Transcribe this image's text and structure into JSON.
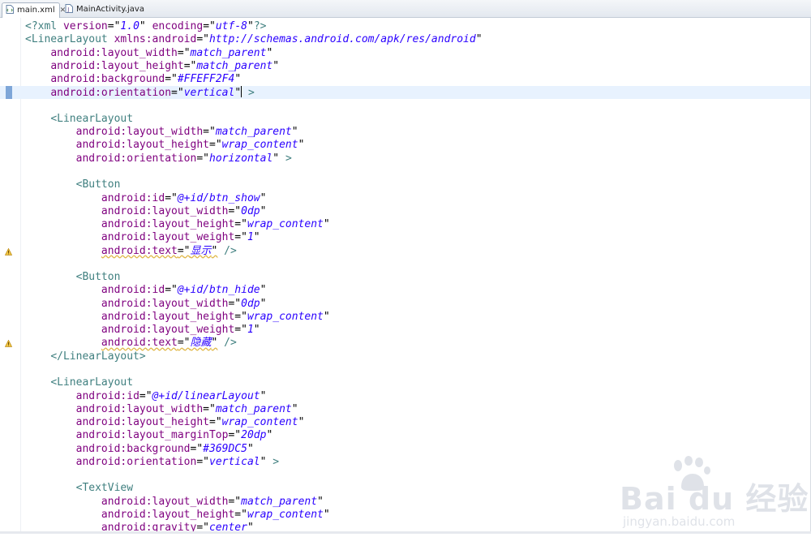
{
  "tabs": [
    {
      "label": "main.xml",
      "icon": "xml-file-icon",
      "close": "✕",
      "active": true
    },
    {
      "label": "MainActivity.java",
      "icon": "java-file-icon",
      "active": false
    }
  ],
  "editor": {
    "lines": [
      {
        "text": "<?xml version=\"1.0\" encoding=\"utf-8\"?>",
        "current": false,
        "warning": false
      },
      {
        "text": "<LinearLayout xmlns:android=\"http://schemas.android.com/apk/res/android\"",
        "current": false,
        "warning": false
      },
      {
        "text": "    android:layout_width=\"match_parent\"",
        "current": false,
        "warning": false
      },
      {
        "text": "    android:layout_height=\"match_parent\"",
        "current": false,
        "warning": false
      },
      {
        "text": "    android:background=\"#FFEFF2F4\"",
        "current": false,
        "warning": false
      },
      {
        "text": "    android:orientation=\"vertical\" >",
        "current": true,
        "warning": false
      },
      {
        "text": "",
        "current": false,
        "warning": false
      },
      {
        "text": "    <LinearLayout",
        "current": false,
        "warning": false
      },
      {
        "text": "        android:layout_width=\"match_parent\"",
        "current": false,
        "warning": false
      },
      {
        "text": "        android:layout_height=\"wrap_content\"",
        "current": false,
        "warning": false
      },
      {
        "text": "        android:orientation=\"horizontal\" >",
        "current": false,
        "warning": false
      },
      {
        "text": "",
        "current": false,
        "warning": false
      },
      {
        "text": "        <Button",
        "current": false,
        "warning": false
      },
      {
        "text": "            android:id=\"@+id/btn_show\"",
        "current": false,
        "warning": false
      },
      {
        "text": "            android:layout_width=\"0dp\"",
        "current": false,
        "warning": false
      },
      {
        "text": "            android:layout_height=\"wrap_content\"",
        "current": false,
        "warning": false
      },
      {
        "text": "            android:layout_weight=\"1\"",
        "current": false,
        "warning": false
      },
      {
        "text": "            android:text=\"显示\" />",
        "current": false,
        "warning": true
      },
      {
        "text": "",
        "current": false,
        "warning": false
      },
      {
        "text": "        <Button",
        "current": false,
        "warning": false
      },
      {
        "text": "            android:id=\"@+id/btn_hide\"",
        "current": false,
        "warning": false
      },
      {
        "text": "            android:layout_width=\"0dp\"",
        "current": false,
        "warning": false
      },
      {
        "text": "            android:layout_height=\"wrap_content\"",
        "current": false,
        "warning": false
      },
      {
        "text": "            android:layout_weight=\"1\"",
        "current": false,
        "warning": false
      },
      {
        "text": "            android:text=\"隐藏\" />",
        "current": false,
        "warning": true
      },
      {
        "text": "    </LinearLayout>",
        "current": false,
        "warning": false
      },
      {
        "text": "",
        "current": false,
        "warning": false
      },
      {
        "text": "    <LinearLayout",
        "current": false,
        "warning": false
      },
      {
        "text": "        android:id=\"@+id/linearLayout\"",
        "current": false,
        "warning": false
      },
      {
        "text": "        android:layout_width=\"match_parent\"",
        "current": false,
        "warning": false
      },
      {
        "text": "        android:layout_height=\"wrap_content\"",
        "current": false,
        "warning": false
      },
      {
        "text": "        android:layout_marginTop=\"20dp\"",
        "current": false,
        "warning": false
      },
      {
        "text": "        android:background=\"#369DC5\"",
        "current": false,
        "warning": false
      },
      {
        "text": "        android:orientation=\"vertical\" >",
        "current": false,
        "warning": false
      },
      {
        "text": "",
        "current": false,
        "warning": false
      },
      {
        "text": "        <TextView",
        "current": false,
        "warning": false
      },
      {
        "text": "            android:layout_width=\"match_parent\"",
        "current": false,
        "warning": false
      },
      {
        "text": "            android:layout_height=\"wrap_content\"",
        "current": false,
        "warning": false
      },
      {
        "text": "            android:gravity=\"center\"",
        "current": false,
        "warning": false
      }
    ]
  },
  "watermark": {
    "main": "Bai du 经验",
    "sub": "jingyan.baidu.com"
  },
  "colors": {
    "tag": "#3f7f7f",
    "attribute": "#7f007f",
    "value": "#2a00ff",
    "current_line": "#e8f2fe",
    "warning": "#e0a020"
  }
}
